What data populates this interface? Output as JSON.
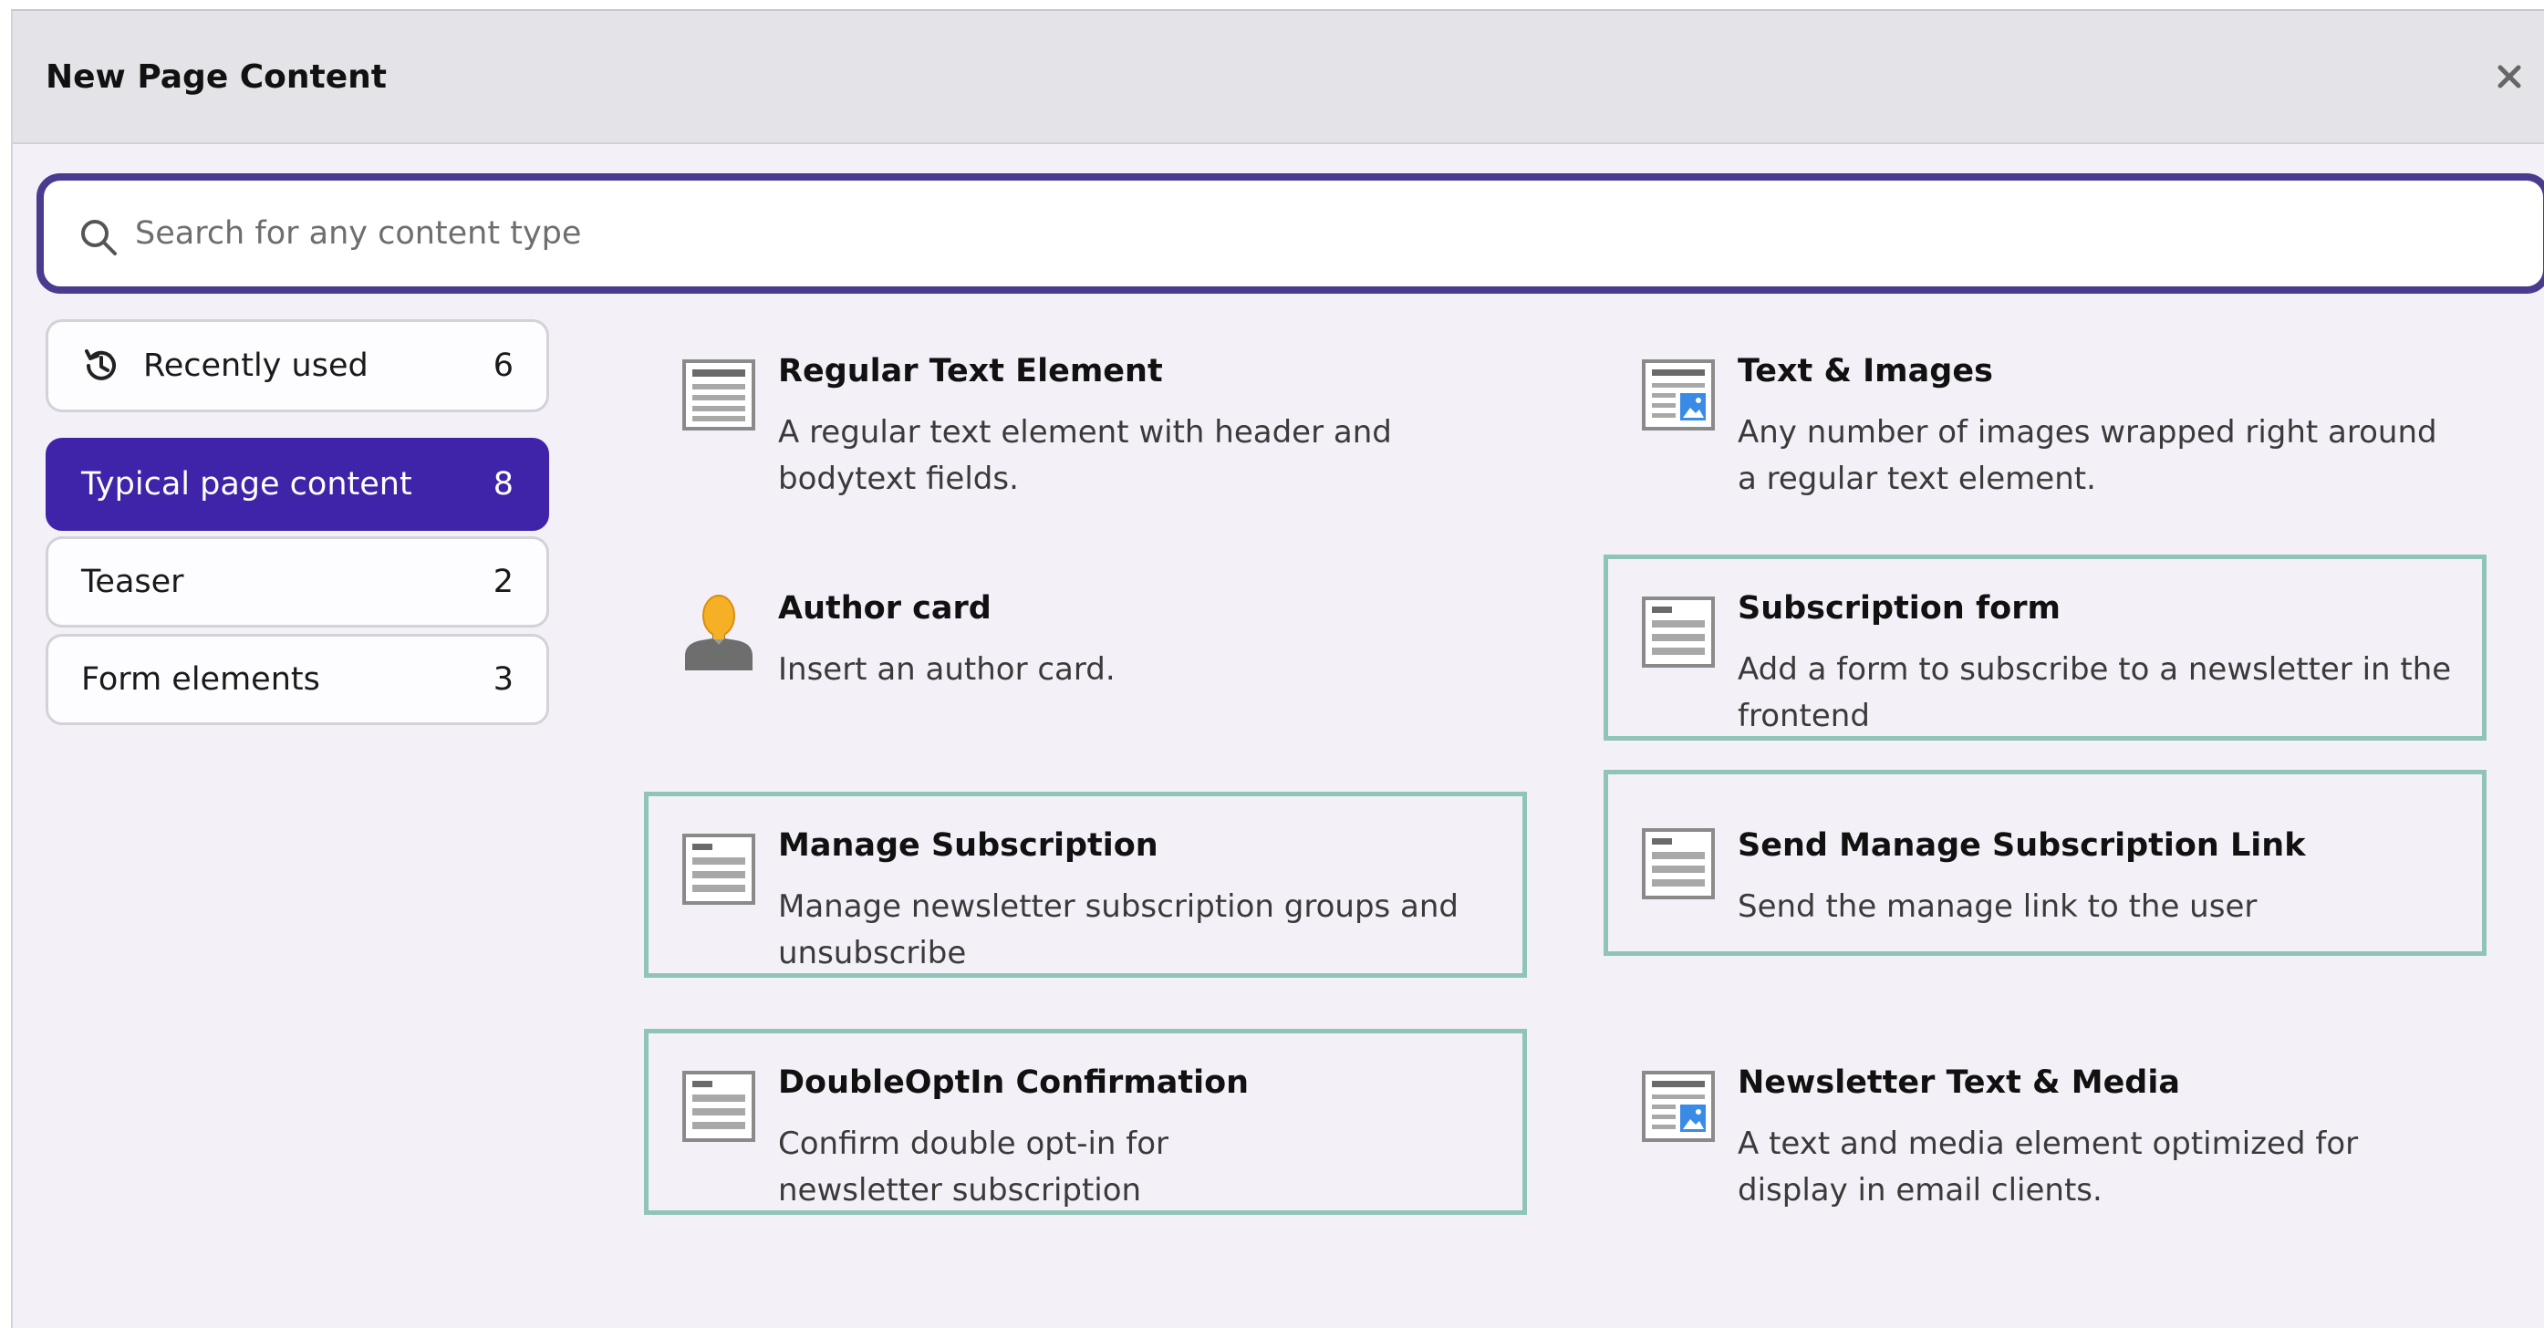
{
  "modal": {
    "title": "New Page Content",
    "close_label": "×"
  },
  "search": {
    "placeholder": "Search for any content type",
    "value": ""
  },
  "categories": [
    {
      "label": "Recently used",
      "count": "6",
      "icon": "history-icon"
    },
    {
      "label": "Typical page content",
      "count": "8",
      "active": true
    },
    {
      "label": "Teaser",
      "count": "2"
    },
    {
      "label": "Form elements",
      "count": "3"
    }
  ],
  "content_types": [
    {
      "name": "Regular Text Element",
      "description": "A regular text element with header and bodytext fields.",
      "icon": "text-document-icon"
    },
    {
      "name": "Text & Images",
      "description": "Any number of images wrapped right around a regular text element.",
      "icon": "text-image-icon"
    },
    {
      "name": "Author card",
      "description": "Insert an author card.",
      "icon": "author-icon"
    },
    {
      "name": "Subscription form",
      "description": "Add a form to subscribe to a newsletter in the frontend",
      "icon": "text-document-icon"
    },
    {
      "name": "Manage Subscription",
      "description": "Manage newsletter subscription groups and unsubscribe",
      "icon": "text-document-icon"
    },
    {
      "name": "Send Manage Subscription Link",
      "description": "Send the manage link to the user",
      "icon": "text-document-icon"
    },
    {
      "name": "DoubleOptIn Confirmation",
      "description": "Confirm double opt-in for newsletter subscription",
      "icon": "text-document-icon"
    },
    {
      "name": "Newsletter Text & Media",
      "description": "A text and media element optimized for display in email clients.",
      "icon": "text-image-icon"
    }
  ],
  "colors": {
    "accent": "#3f23a8",
    "search_border": "#4a3b8f",
    "card_highlight_border": "#8fc4b8",
    "modal_background": "#f4f0f7",
    "header_background": "#e4e4e8"
  }
}
